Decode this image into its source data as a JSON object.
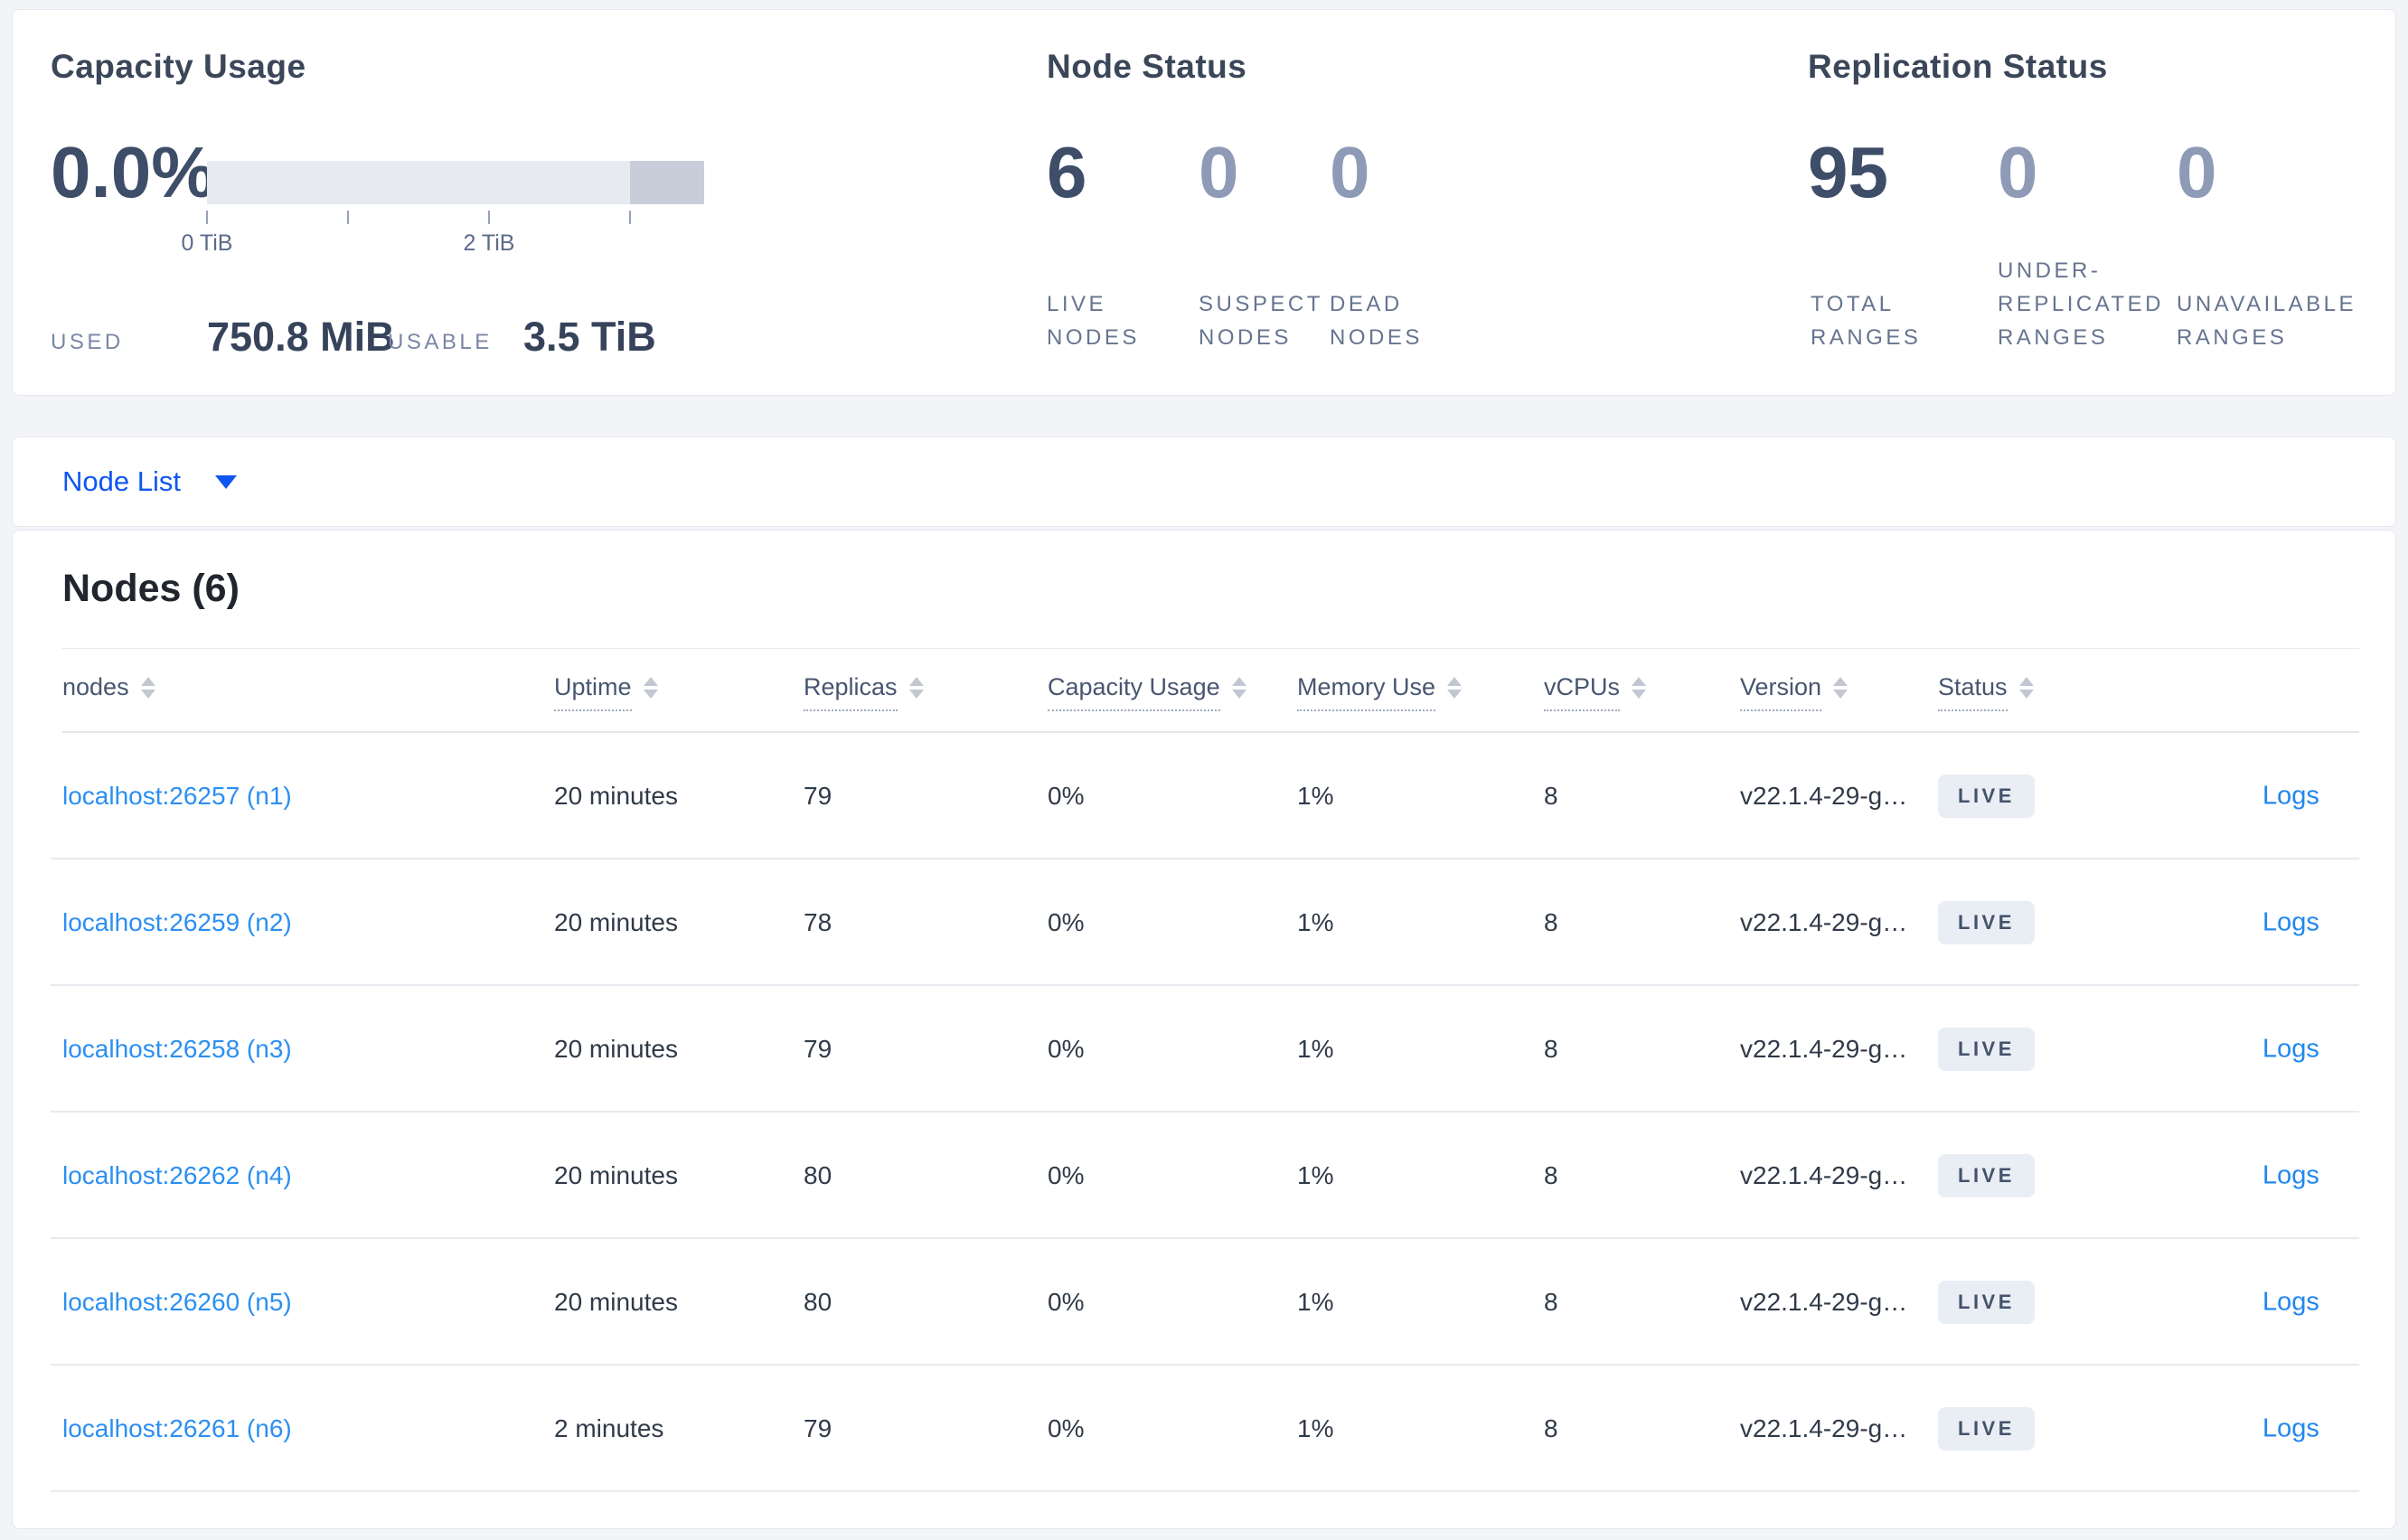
{
  "colors": {
    "page_bg": "#f3f4f8",
    "accent_blue": "#0f56f0",
    "link_blue": "#2b8ff2",
    "dark_number": "#3e4d68",
    "muted_number": "#8e9ab6",
    "bar_light": "#e8eaf1",
    "bar_dark": "#c9cdda",
    "badge_bg": "#e9edf4"
  },
  "capacity": {
    "title": "Capacity Usage",
    "percent": "0.0%",
    "tick_labels": [
      "0 TiB",
      "2 TiB"
    ],
    "used_label": "USED",
    "used_value": "750.8 MiB",
    "usable_label": "USABLE",
    "usable_value": "3.5 TiB"
  },
  "node_status": {
    "title": "Node Status",
    "stats": [
      {
        "value": "6",
        "muted": false,
        "label_lines": [
          "LIVE",
          "NODES"
        ]
      },
      {
        "value": "0",
        "muted": true,
        "label_lines": [
          "SUSPECT",
          "NODES"
        ]
      },
      {
        "value": "0",
        "muted": true,
        "label_lines": [
          "DEAD",
          "NODES"
        ]
      }
    ]
  },
  "replication_status": {
    "title": "Replication Status",
    "stats": [
      {
        "value": "95",
        "muted": false,
        "label_lines": [
          "TOTAL",
          "RANGES"
        ]
      },
      {
        "value": "0",
        "muted": true,
        "label_lines": [
          "UNDER-",
          "REPLICATED",
          "RANGES"
        ]
      },
      {
        "value": "0",
        "muted": true,
        "label_lines": [
          "UNAVAILABLE",
          "RANGES"
        ]
      }
    ]
  },
  "nodelist": {
    "label": "Node List"
  },
  "table": {
    "title": "Nodes (6)",
    "columns": [
      {
        "key": "node",
        "label": "nodes",
        "tooltip": false
      },
      {
        "key": "uptime",
        "label": "Uptime",
        "tooltip": true
      },
      {
        "key": "replicas",
        "label": "Replicas",
        "tooltip": true
      },
      {
        "key": "capacity",
        "label": "Capacity Usage",
        "tooltip": true
      },
      {
        "key": "memory",
        "label": "Memory Use",
        "tooltip": true
      },
      {
        "key": "vcpus",
        "label": "vCPUs",
        "tooltip": true
      },
      {
        "key": "version",
        "label": "Version",
        "tooltip": true
      },
      {
        "key": "status",
        "label": "Status",
        "tooltip": true
      }
    ],
    "rows": [
      {
        "node": "localhost:26257 (n1)",
        "uptime": "20 minutes",
        "replicas": "79",
        "capacity": "0%",
        "memory": "1%",
        "vcpus": "8",
        "version": "v22.1.4-29-g…",
        "status": "LIVE",
        "logs": "Logs"
      },
      {
        "node": "localhost:26259 (n2)",
        "uptime": "20 minutes",
        "replicas": "78",
        "capacity": "0%",
        "memory": "1%",
        "vcpus": "8",
        "version": "v22.1.4-29-g…",
        "status": "LIVE",
        "logs": "Logs"
      },
      {
        "node": "localhost:26258 (n3)",
        "uptime": "20 minutes",
        "replicas": "79",
        "capacity": "0%",
        "memory": "1%",
        "vcpus": "8",
        "version": "v22.1.4-29-g…",
        "status": "LIVE",
        "logs": "Logs"
      },
      {
        "node": "localhost:26262 (n4)",
        "uptime": "20 minutes",
        "replicas": "80",
        "capacity": "0%",
        "memory": "1%",
        "vcpus": "8",
        "version": "v22.1.4-29-g…",
        "status": "LIVE",
        "logs": "Logs"
      },
      {
        "node": "localhost:26260 (n5)",
        "uptime": "20 minutes",
        "replicas": "80",
        "capacity": "0%",
        "memory": "1%",
        "vcpus": "8",
        "version": "v22.1.4-29-g…",
        "status": "LIVE",
        "logs": "Logs"
      },
      {
        "node": "localhost:26261 (n6)",
        "uptime": "2 minutes",
        "replicas": "79",
        "capacity": "0%",
        "memory": "1%",
        "vcpus": "8",
        "version": "v22.1.4-29-g…",
        "status": "LIVE",
        "logs": "Logs"
      }
    ]
  }
}
